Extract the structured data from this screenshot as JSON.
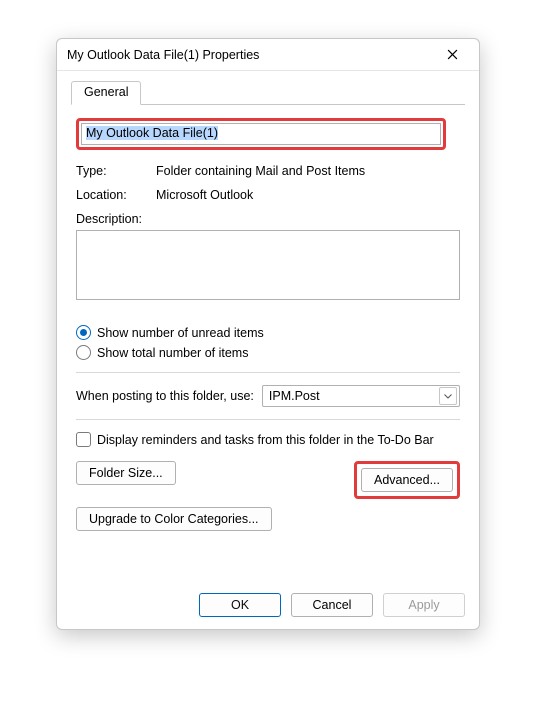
{
  "window": {
    "title": "My Outlook Data File(1) Properties"
  },
  "tabs": {
    "general": "General"
  },
  "form": {
    "name_value": "My Outlook Data File(1)",
    "type_label": "Type:",
    "type_value": "Folder containing Mail and Post Items",
    "location_label": "Location:",
    "location_value": "Microsoft Outlook",
    "description_label": "Description:",
    "description_value": ""
  },
  "display": {
    "radio_unread": "Show number of unread items",
    "radio_total": "Show total number of items"
  },
  "posting": {
    "label": "When posting to this folder, use:",
    "value": "IPM.Post"
  },
  "reminders": {
    "checkbox_label": "Display reminders and tasks from this folder in the To-Do Bar"
  },
  "buttons": {
    "folder_size": "Folder Size...",
    "advanced": "Advanced...",
    "upgrade": "Upgrade to Color Categories...",
    "ok": "OK",
    "cancel": "Cancel",
    "apply": "Apply"
  }
}
